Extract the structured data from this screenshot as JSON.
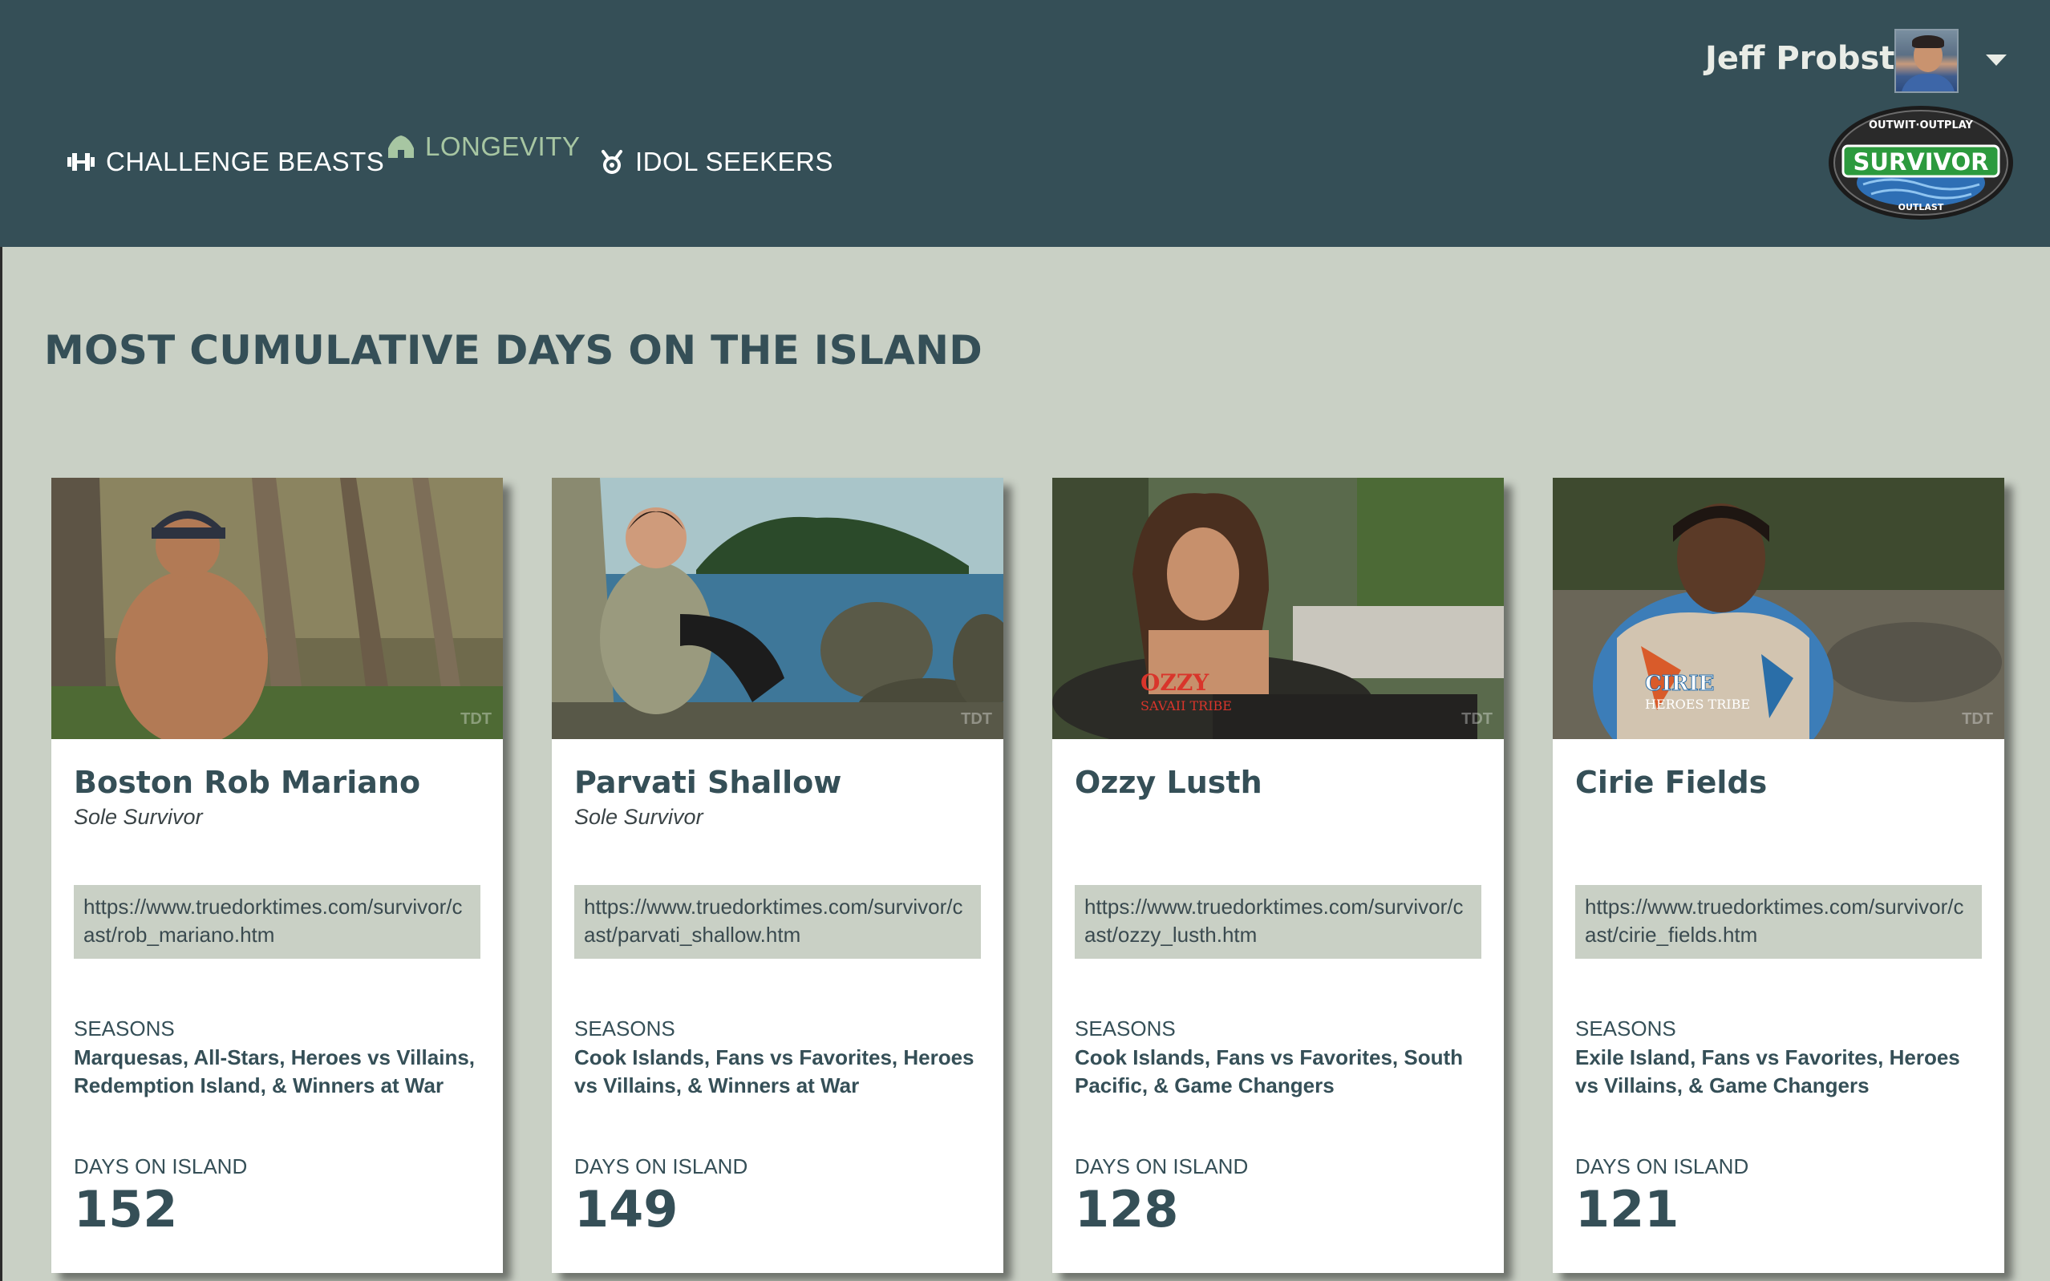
{
  "nav": {
    "items": [
      {
        "label": "CHALLENGE BEASTS",
        "icon": "dumbbell-icon",
        "active": false
      },
      {
        "label": "LONGEVITY",
        "icon": "hut-icon",
        "active": true
      },
      {
        "label": "IDOL SEEKERS",
        "icon": "idol-icon",
        "active": false
      }
    ]
  },
  "user": {
    "name": "Jeff Probst"
  },
  "logo": {
    "text": "SURVIVOR",
    "top_arc": "OUTWIT·OUTPLAY",
    "bottom_arc": "OUTLAST"
  },
  "page": {
    "title": "MOST CUMULATIVE DAYS ON THE ISLAND"
  },
  "labels": {
    "seasons": "SEASONS",
    "days": "DAYS ON ISLAND"
  },
  "players": [
    {
      "name": "Boston Rob Mariano",
      "title": "Sole Survivor",
      "url": "https://www.truedorktimes.com/survivor/cast/rob_mariano.htm",
      "seasons": "Marquesas, All-Stars, Heroes vs Villains, Redemption Island, & Winners at War",
      "days": "152",
      "photo_caption": "",
      "photo_tribe": ""
    },
    {
      "name": "Parvati Shallow",
      "title": "Sole Survivor",
      "url": "https://www.truedorktimes.com/survivor/cast/parvati_shallow.htm",
      "seasons": "Cook Islands, Fans vs Favorites, Heroes vs Villains, & Winners at War",
      "days": "149",
      "photo_caption": "",
      "photo_tribe": ""
    },
    {
      "name": "Ozzy Lusth",
      "title": "",
      "url": "https://www.truedorktimes.com/survivor/cast/ozzy_lusth.htm",
      "seasons": "Cook Islands, Fans vs Favorites, South Pacific, & Game Changers",
      "days": "128",
      "photo_caption": "OZZY",
      "photo_tribe": "SAVAII TRIBE"
    },
    {
      "name": "Cirie Fields",
      "title": "",
      "url": "https://www.truedorktimes.com/survivor/cast/cirie_fields.htm",
      "seasons": "Exile Island, Fans vs Favorites, Heroes vs Villains, & Game Changers",
      "days": "121",
      "photo_caption": "CIRIE",
      "photo_tribe": "HEROES TRIBE"
    }
  ],
  "watermark": "TDT"
}
